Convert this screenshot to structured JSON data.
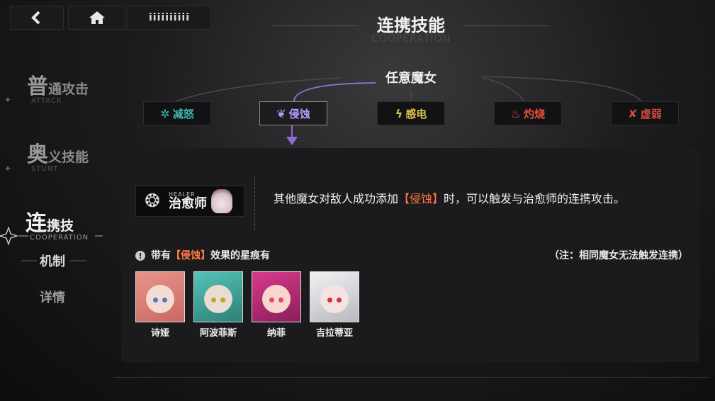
{
  "topbar": {
    "back_icon": "back-arrow-icon",
    "home_icon": "home-icon",
    "menu_text": "iiiiiiiiii"
  },
  "header": {
    "title": "连携技能",
    "subtitle": "COOPERATION"
  },
  "sidebar": {
    "items": [
      {
        "big": "普",
        "small": "通攻击",
        "en": "ATTACK"
      },
      {
        "big": "奥",
        "small": "义技能",
        "en": "STUNT"
      },
      {
        "big": "连",
        "small": "携技",
        "en": "COOPERATION"
      }
    ],
    "sub_items": [
      "机制",
      "详情"
    ]
  },
  "category": {
    "label": "任意魔女"
  },
  "tabs": [
    {
      "label": "减怒",
      "icon": "rage-reduce-icon",
      "color": "#3fb8b0"
    },
    {
      "label": "侵蚀",
      "icon": "erosion-icon",
      "color": "#b49aff"
    },
    {
      "label": "感电",
      "icon": "lightning-icon",
      "color": "#d8c34a"
    },
    {
      "label": "灼烧",
      "icon": "fire-icon",
      "color": "#e8503a"
    },
    {
      "label": "虚弱",
      "icon": "weaken-icon",
      "color": "#d44a40"
    }
  ],
  "panel": {
    "badge": {
      "en": "HEALER",
      "cn": "治愈师"
    },
    "desc_pre": "其他魔女对敌人成功添加",
    "desc_hl": "【侵蚀】",
    "desc_post": "时，可以触发与治愈师的连携攻击。",
    "note_pre": "带有",
    "note_hl": "【侵蚀】",
    "note_post": "效果的星痕有",
    "note_right": "（注：相同魔女无法触发连携）",
    "characters": [
      {
        "name": "诗娅",
        "hair": "#e07a72",
        "eye": "#4a7cc8"
      },
      {
        "name": "阿波菲斯",
        "hair": "#3fa59a",
        "eye": "#c8a030"
      },
      {
        "name": "纳菲",
        "hair": "#c02e78",
        "eye": "#e04a6a"
      },
      {
        "name": "吉拉蒂亚",
        "hair": "#e6e6ea",
        "eye": "#d03040"
      }
    ]
  },
  "colors": {
    "accent_purple": "#8a6fd0",
    "highlight_orange": "#ff7a45"
  }
}
